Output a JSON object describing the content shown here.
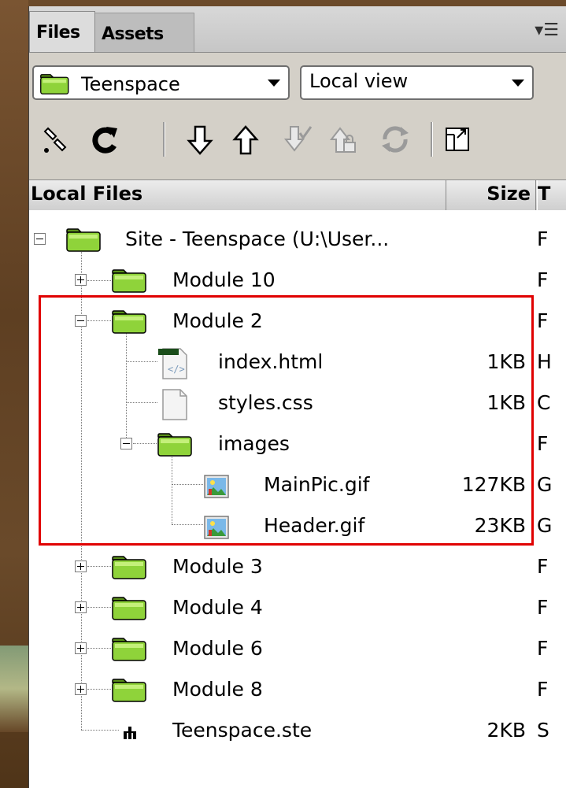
{
  "tabs": {
    "files": "Files",
    "assets": "Assets"
  },
  "panel_menu_icon": "panel-options-icon",
  "toolbar": {
    "site_select": "Teenspace",
    "view_select": "Local view",
    "tools": [
      "connect-icon",
      "refresh-icon",
      "get-files-icon",
      "put-files-icon",
      "check-out-icon",
      "check-in-icon",
      "synchronize-icon",
      "expand-panel-icon"
    ]
  },
  "columns": {
    "local": "Local Files",
    "size": "Size",
    "type": "T"
  },
  "tree": {
    "root": {
      "label": "Site - Teenspace (U:\\User...",
      "type": "F"
    },
    "module10": {
      "label": "Module 10",
      "type": "F"
    },
    "module2": {
      "label": "Module 2",
      "type": "F"
    },
    "index": {
      "label": "index.html",
      "size": "1KB",
      "type": "H"
    },
    "styles": {
      "label": "styles.css",
      "size": "1KB",
      "type": "C"
    },
    "images": {
      "label": "images",
      "type": "F"
    },
    "mainpic": {
      "label": "MainPic.gif",
      "size": "127KB",
      "type": "G"
    },
    "header": {
      "label": "Header.gif",
      "size": "23KB",
      "type": "G"
    },
    "module3": {
      "label": "Module 3",
      "type": "F"
    },
    "module4": {
      "label": "Module 4",
      "type": "F"
    },
    "module6": {
      "label": "Module 6",
      "type": "F"
    },
    "module8": {
      "label": "Module 8",
      "type": "F"
    },
    "ste": {
      "label": "Teenspace.ste",
      "size": "2KB",
      "type": "S"
    }
  },
  "colors": {
    "highlight": "#e00000",
    "folder": "#7ec42a",
    "panel": "#d4d0c8"
  }
}
